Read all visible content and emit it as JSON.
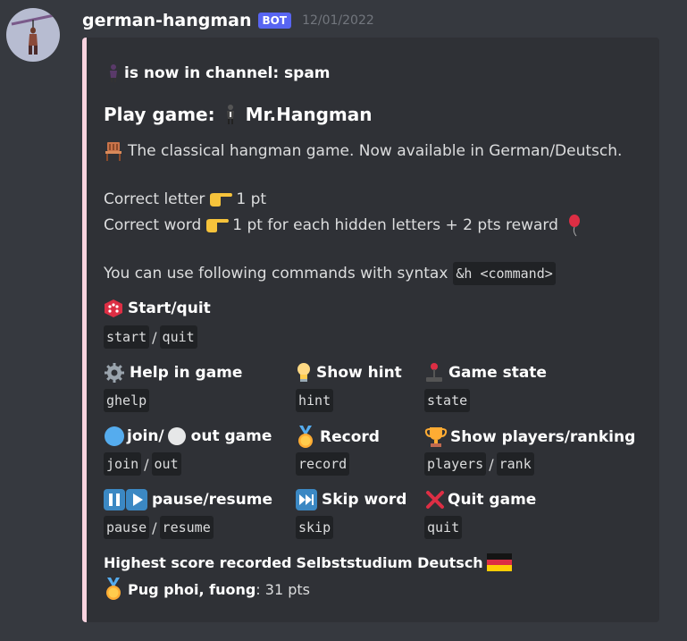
{
  "message": {
    "username": "german-hangman",
    "badge": "BOT",
    "timestamp": "12/01/2022"
  },
  "embed": {
    "accent_color": "#f9d3df",
    "author": "is now in channel: spam",
    "title_prefix": "Play game:",
    "title_name": "Mr.Hangman",
    "description": "The classical hangman game. Now available in German/Deutsch.",
    "scoring": [
      {
        "label": "Correct letter",
        "text": "1 pt"
      },
      {
        "label": "Correct word",
        "text": "1 pt for each hidden letters + 2 pts reward"
      }
    ],
    "syntax_text": "You can use following commands with syntax",
    "syntax_code": "&h <command>",
    "fields": {
      "start": {
        "name": "Start/quit",
        "cmds": [
          "start",
          "quit"
        ]
      },
      "help": {
        "name": "Help in game",
        "cmds": [
          "ghelp"
        ]
      },
      "hint": {
        "name": "Show hint",
        "cmds": [
          "hint"
        ]
      },
      "state": {
        "name": "Game state",
        "cmds": [
          "state"
        ]
      },
      "join": {
        "name_a": "join/",
        "name_b": "out game",
        "cmds": [
          "join",
          "out"
        ]
      },
      "record": {
        "name": "Record",
        "cmds": [
          "record"
        ]
      },
      "players": {
        "name": "Show players/ranking",
        "cmds": [
          "players",
          "rank"
        ]
      },
      "pause": {
        "name": "pause/resume",
        "cmds": [
          "pause",
          "resume"
        ]
      },
      "skip": {
        "name": "Skip word",
        "cmds": [
          "skip"
        ]
      },
      "quit": {
        "name": "Quit game",
        "cmds": [
          "quit"
        ]
      },
      "highscore": {
        "name_prefix": "Highest score recorded",
        "name_guild": "Selbststudium Deutsch",
        "player": "Pug phoi, fuong",
        "score": ": 31 pts"
      }
    },
    "separator": "/"
  },
  "icons": [
    "avatar-hangman",
    "man-in-suit-levitating-icon",
    "chair-icon",
    "pointing-right-icon",
    "balloon-icon",
    "die-icon",
    "gear-icon",
    "light-bulb-icon",
    "joystick-icon",
    "blue-circle-icon",
    "white-circle-icon",
    "medal-icon",
    "trophy-icon",
    "pause-icon",
    "play-icon",
    "next-track-icon",
    "cross-mark-icon",
    "germany-flag-icon"
  ]
}
